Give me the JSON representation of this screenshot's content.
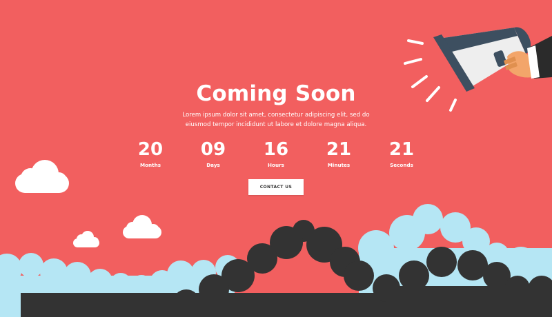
{
  "hero": {
    "title": "Coming Soon",
    "description": "Lorem ipsum dolor sit amet, consectetur adipiscing elit, sed do eiusmod tempor incididunt ut labore et dolore magna aliqua."
  },
  "countdown": [
    {
      "value": "20",
      "label": "Months"
    },
    {
      "value": "09",
      "label": "Days"
    },
    {
      "value": "16",
      "label": "Hours"
    },
    {
      "value": "21",
      "label": "Minutes"
    },
    {
      "value": "21",
      "label": "Seconds"
    }
  ],
  "contact_button": {
    "label": "CONTACT US"
  },
  "illustration": {
    "megaphone": "megaphone-icon",
    "hand": "hand-icon",
    "clouds": "cloud-icon"
  },
  "colors": {
    "background": "#f25f5f",
    "cloud_light_blue": "#b5e6f4",
    "cloud_dark": "#333333",
    "megaphone_body": "#3d4f60",
    "megaphone_cone": "#eeeeee",
    "hand_skin": "#f3a56a"
  }
}
